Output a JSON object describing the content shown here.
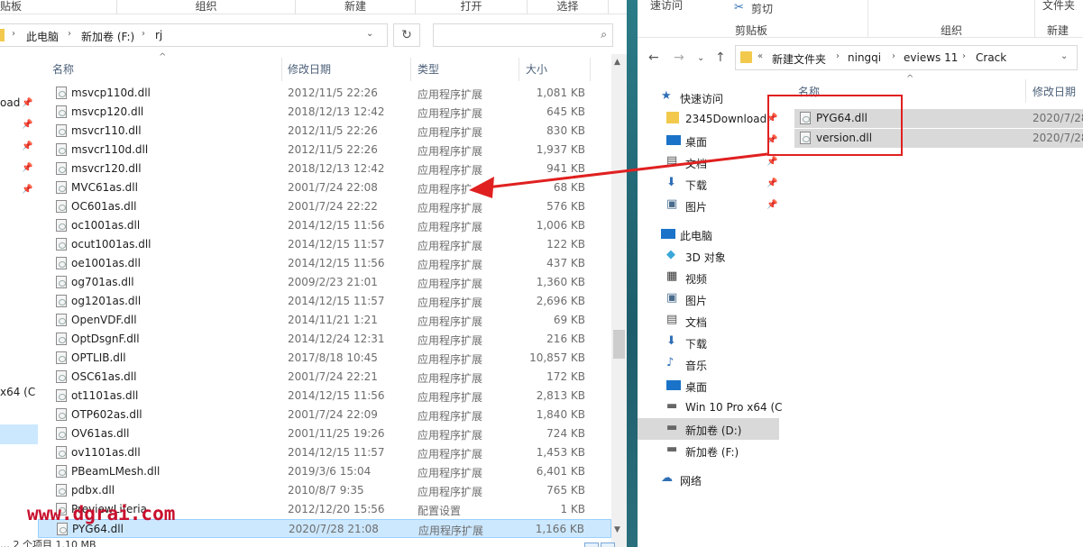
{
  "left_window": {
    "ribbon_groups": [
      "贴板",
      "组织",
      "新建",
      "打开",
      "选择"
    ],
    "breadcrumb": [
      "此电脑",
      "新加卷 (F:)",
      "rj"
    ],
    "search_placeholder": "",
    "nav_fragments": [
      "oad",
      "x64 (C"
    ],
    "columns": {
      "name": "名称",
      "modified": "修改日期",
      "type": "类型",
      "size": "大小"
    },
    "files": [
      {
        "name": "msvcp110d.dll",
        "modified": "2012/11/5 22:26",
        "type": "应用程序扩展",
        "size": "1,081 KB"
      },
      {
        "name": "msvcp120.dll",
        "modified": "2018/12/13 12:42",
        "type": "应用程序扩展",
        "size": "645 KB"
      },
      {
        "name": "msvcr110.dll",
        "modified": "2012/11/5 22:26",
        "type": "应用程序扩展",
        "size": "830 KB"
      },
      {
        "name": "msvcr110d.dll",
        "modified": "2012/11/5 22:26",
        "type": "应用程序扩展",
        "size": "1,937 KB"
      },
      {
        "name": "msvcr120.dll",
        "modified": "2018/12/13 12:42",
        "type": "应用程序扩展",
        "size": "941 KB"
      },
      {
        "name": "MVC61as.dll",
        "modified": "2001/7/24 22:08",
        "type": "应用程序扩",
        "size": "68 KB"
      },
      {
        "name": "OC601as.dll",
        "modified": "2001/7/24 22:22",
        "type": "应用程序扩展",
        "size": "576 KB"
      },
      {
        "name": "oc1001as.dll",
        "modified": "2014/12/15 11:56",
        "type": "应用程序扩展",
        "size": "1,006 KB"
      },
      {
        "name": "ocut1001as.dll",
        "modified": "2014/12/15 11:57",
        "type": "应用程序扩展",
        "size": "122 KB"
      },
      {
        "name": "oe1001as.dll",
        "modified": "2014/12/15 11:56",
        "type": "应用程序扩展",
        "size": "437 KB"
      },
      {
        "name": "og701as.dll",
        "modified": "2009/2/23 21:01",
        "type": "应用程序扩展",
        "size": "1,360 KB"
      },
      {
        "name": "og1201as.dll",
        "modified": "2014/12/15 11:57",
        "type": "应用程序扩展",
        "size": "2,696 KB"
      },
      {
        "name": "OpenVDF.dll",
        "modified": "2014/11/21 1:21",
        "type": "应用程序扩展",
        "size": "69 KB"
      },
      {
        "name": "OptDsgnF.dll",
        "modified": "2014/12/24 12:31",
        "type": "应用程序扩展",
        "size": "216 KB"
      },
      {
        "name": "OPTLIB.dll",
        "modified": "2017/8/18 10:45",
        "type": "应用程序扩展",
        "size": "10,857 KB"
      },
      {
        "name": "OSC61as.dll",
        "modified": "2001/7/24 22:21",
        "type": "应用程序扩展",
        "size": "172 KB"
      },
      {
        "name": "ot1101as.dll",
        "modified": "2014/12/15 11:56",
        "type": "应用程序扩展",
        "size": "2,813 KB"
      },
      {
        "name": "OTP602as.dll",
        "modified": "2001/7/24 22:09",
        "type": "应用程序扩展",
        "size": "1,840 KB"
      },
      {
        "name": "OV61as.dll",
        "modified": "2001/11/25 19:26",
        "type": "应用程序扩展",
        "size": "724 KB"
      },
      {
        "name": "ov1101as.dll",
        "modified": "2014/12/15 11:57",
        "type": "应用程序扩展",
        "size": "1,453 KB"
      },
      {
        "name": "PBeamLMesh.dll",
        "modified": "2019/3/6 15:04",
        "type": "应用程序扩展",
        "size": "6,401 KB"
      },
      {
        "name": "pdbx.dll",
        "modified": "2010/8/7 9:35",
        "type": "应用程序扩展",
        "size": "765 KB"
      },
      {
        "name": "PreviewLiferia",
        "modified": "2012/12/20 15:56",
        "type": "配置设置",
        "size": "1 KB"
      },
      {
        "name": "PYG64.dll",
        "modified": "2020/7/28 21:08",
        "type": "应用程序扩展",
        "size": "1,166 KB",
        "selected": true
      }
    ],
    "status_fragment": "… 2 个项目   1.10 MB",
    "watermark": "www.dgrai.com"
  },
  "right_window": {
    "ribbon": {
      "quick_access": "速访问",
      "cut": "剪切",
      "clipboard": "剪贴板",
      "organize": "组织",
      "new": "新建",
      "file_ops": "文件夹"
    },
    "breadcrumb": [
      "新建文件夹",
      "ningqi",
      "eviews 11",
      "Crack"
    ],
    "tree": [
      {
        "label": "快速访问",
        "icon": "star",
        "level": 0
      },
      {
        "label": "2345Download",
        "icon": "folder",
        "level": 1,
        "pin": true
      },
      {
        "label": "桌面",
        "icon": "desktop",
        "level": 1,
        "pin": true
      },
      {
        "label": "文档",
        "icon": "document",
        "level": 1,
        "pin": true
      },
      {
        "label": "下载",
        "icon": "download",
        "level": 1,
        "pin": true
      },
      {
        "label": "图片",
        "icon": "picture",
        "level": 1,
        "pin": true
      },
      {
        "label": "此电脑",
        "icon": "computer",
        "level": 0
      },
      {
        "label": "3D 对象",
        "icon": "cube",
        "level": 1
      },
      {
        "label": "视频",
        "icon": "video",
        "level": 1
      },
      {
        "label": "图片",
        "icon": "picture",
        "level": 1
      },
      {
        "label": "文档",
        "icon": "document",
        "level": 1
      },
      {
        "label": "下载",
        "icon": "download",
        "level": 1
      },
      {
        "label": "音乐",
        "icon": "music",
        "level": 1
      },
      {
        "label": "桌面",
        "icon": "desktop",
        "level": 1
      },
      {
        "label": "Win 10 Pro x64 (C",
        "icon": "drive-system",
        "level": 1
      },
      {
        "label": "新加卷 (D:)",
        "icon": "drive",
        "level": 1,
        "selected": true
      },
      {
        "label": "新加卷 (F:)",
        "icon": "drive",
        "level": 1
      },
      {
        "label": "网络",
        "icon": "network",
        "level": 0
      }
    ],
    "columns": {
      "name": "名称",
      "modified": "修改日期"
    },
    "files": [
      {
        "name": "PYG64.dll",
        "modified": "2020/7/28"
      },
      {
        "name": "version.dll",
        "modified": "2020/7/28"
      }
    ]
  },
  "colors": {
    "selection": "#cce8ff",
    "annotation": "#e02020",
    "watermark": "#c8102e"
  }
}
